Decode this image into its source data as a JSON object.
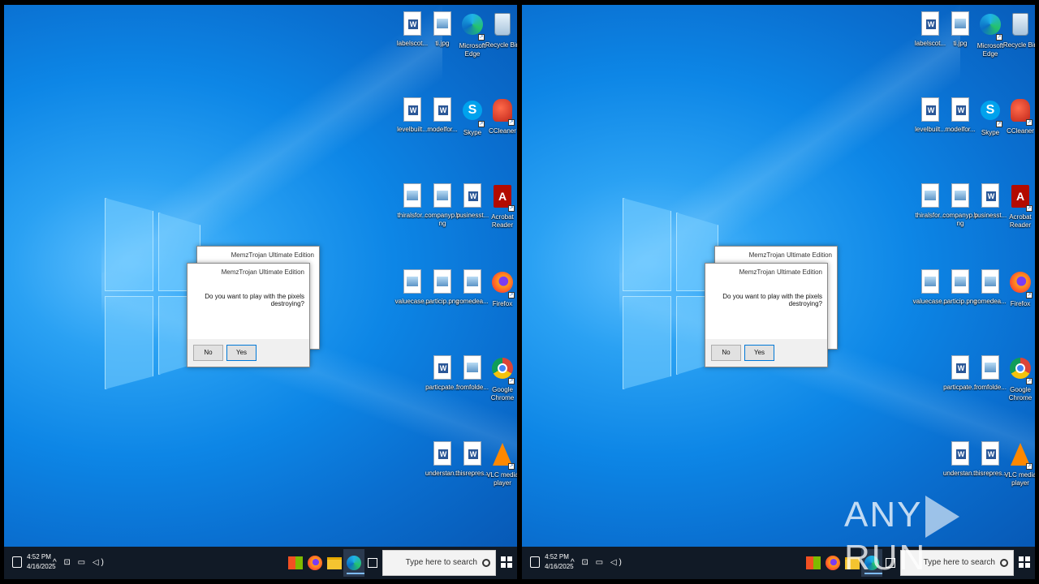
{
  "screens": [
    "left",
    "right"
  ],
  "desktop_icons": [
    {
      "id": "recycle-bin",
      "label": "Recycle Bin",
      "kind": "bin"
    },
    {
      "id": "edge",
      "label": "Microsoft Edge",
      "kind": "edge"
    },
    {
      "id": "file-1",
      "label": "ti.jpg",
      "kind": "image"
    },
    {
      "id": "file-2",
      "label": "labelscot...",
      "kind": "word"
    },
    {
      "id": "ccleaner",
      "label": "CCleaner",
      "kind": "ccl"
    },
    {
      "id": "skype",
      "label": "Skype",
      "kind": "skype"
    },
    {
      "id": "file-3",
      "label": "modelfor...",
      "kind": "word"
    },
    {
      "id": "file-4",
      "label": "levelbuilt...",
      "kind": "word"
    },
    {
      "id": "acrobat",
      "label": "Acrobat Reader",
      "kind": "pdf"
    },
    {
      "id": "file-5",
      "label": "businesst...",
      "kind": "word"
    },
    {
      "id": "file-6",
      "label": "companyp.png",
      "kind": "image"
    },
    {
      "id": "file-7",
      "label": "thiralsfor...",
      "kind": "image"
    },
    {
      "id": "firefox",
      "label": "Firefox",
      "kind": "ff"
    },
    {
      "id": "file-8",
      "label": "comedea...",
      "kind": "image"
    },
    {
      "id": "file-9",
      "label": "particip.png",
      "kind": "image"
    },
    {
      "id": "file-10",
      "label": "valuecase...",
      "kind": "image"
    },
    {
      "id": "chrome",
      "label": "Google Chrome",
      "kind": "chrome"
    },
    {
      "id": "file-11",
      "label": "fromfolde...",
      "kind": "image"
    },
    {
      "id": "file-12",
      "label": "particpate...",
      "kind": "word"
    },
    {
      "id": "vlc",
      "label": "VLC media player",
      "kind": "vlc"
    },
    {
      "id": "file-13",
      "label": "thisrepres...",
      "kind": "word"
    },
    {
      "id": "file-14",
      "label": "understan...",
      "kind": "word"
    }
  ],
  "dialog_back": {
    "title": "MemzTrojan Ultimate Edition"
  },
  "dialog_front": {
    "title": "MemzTrojan Ultimate Edition",
    "message": "Do you want to play with the pixels destroying? ",
    "no_label": "No",
    "yes_label": "Yes"
  },
  "taskbar": {
    "time": "4:52 PM",
    "date": "4/16/2025",
    "search_placeholder": "Type here to search",
    "tray": "^ ⊡ ▭ ◁)"
  },
  "watermark": {
    "left": "ANY",
    "right": "RUN"
  }
}
